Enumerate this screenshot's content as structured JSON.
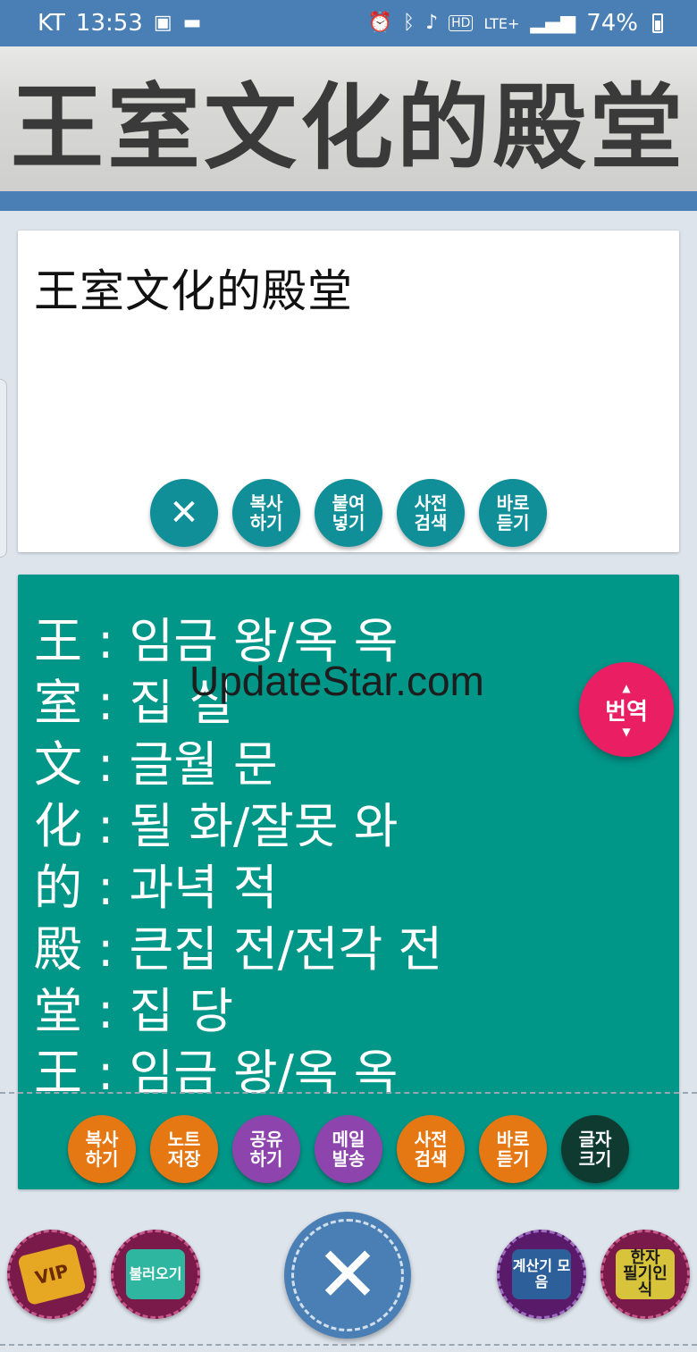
{
  "status_bar": {
    "carrier": "KT",
    "time": "13:53",
    "network": "LTE+",
    "battery": "74%",
    "icons": [
      "image-icon",
      "message-icon",
      "alarm-icon",
      "bluetooth-icon",
      "mute-icon",
      "hd-icon",
      "signal-icon",
      "battery-icon"
    ]
  },
  "banner": {
    "captured_text": "王室文化的殿堂"
  },
  "input": {
    "text": "王室文化的殿堂",
    "buttons": {
      "clear": "✕",
      "copy": "복사\n하기",
      "paste": "붙여\n넣기",
      "dict_search": "사전\n검색",
      "listen": "바로\n듣기"
    }
  },
  "result": {
    "lines": [
      "王 : 임금 왕/옥 옥",
      "室 : 집 실",
      "文 : 글월 문",
      "化 : 될 화/잘못 와",
      "的 : 과녁 적",
      "殿 : 큰집 전/전각 전",
      "堂 : 집 당",
      "王 : 임금 왕/옥 옥"
    ],
    "watermark": "UpdateStar.com",
    "translate_label": "번역",
    "buttons": {
      "copy": "복사\n하기",
      "save_note": "노트\n저장",
      "share": "공유\n하기",
      "send_mail": "메일\n발송",
      "dict_search": "사전\n검색",
      "listen": "바로\n듣기",
      "font_size": "글자\n크기"
    }
  },
  "bottom_bar": {
    "vip_label": "VIP",
    "load_label": "불러오기",
    "close_label": "✕",
    "calc_label": "계산기 모음",
    "handwriting_label": "한자\n필기인식"
  },
  "colors": {
    "primary": "#4a7fb5",
    "teal": "#108f99",
    "result_bg": "#009688",
    "translate": "#e91e63",
    "orange": "#e67814",
    "purple": "#8e44ad"
  }
}
